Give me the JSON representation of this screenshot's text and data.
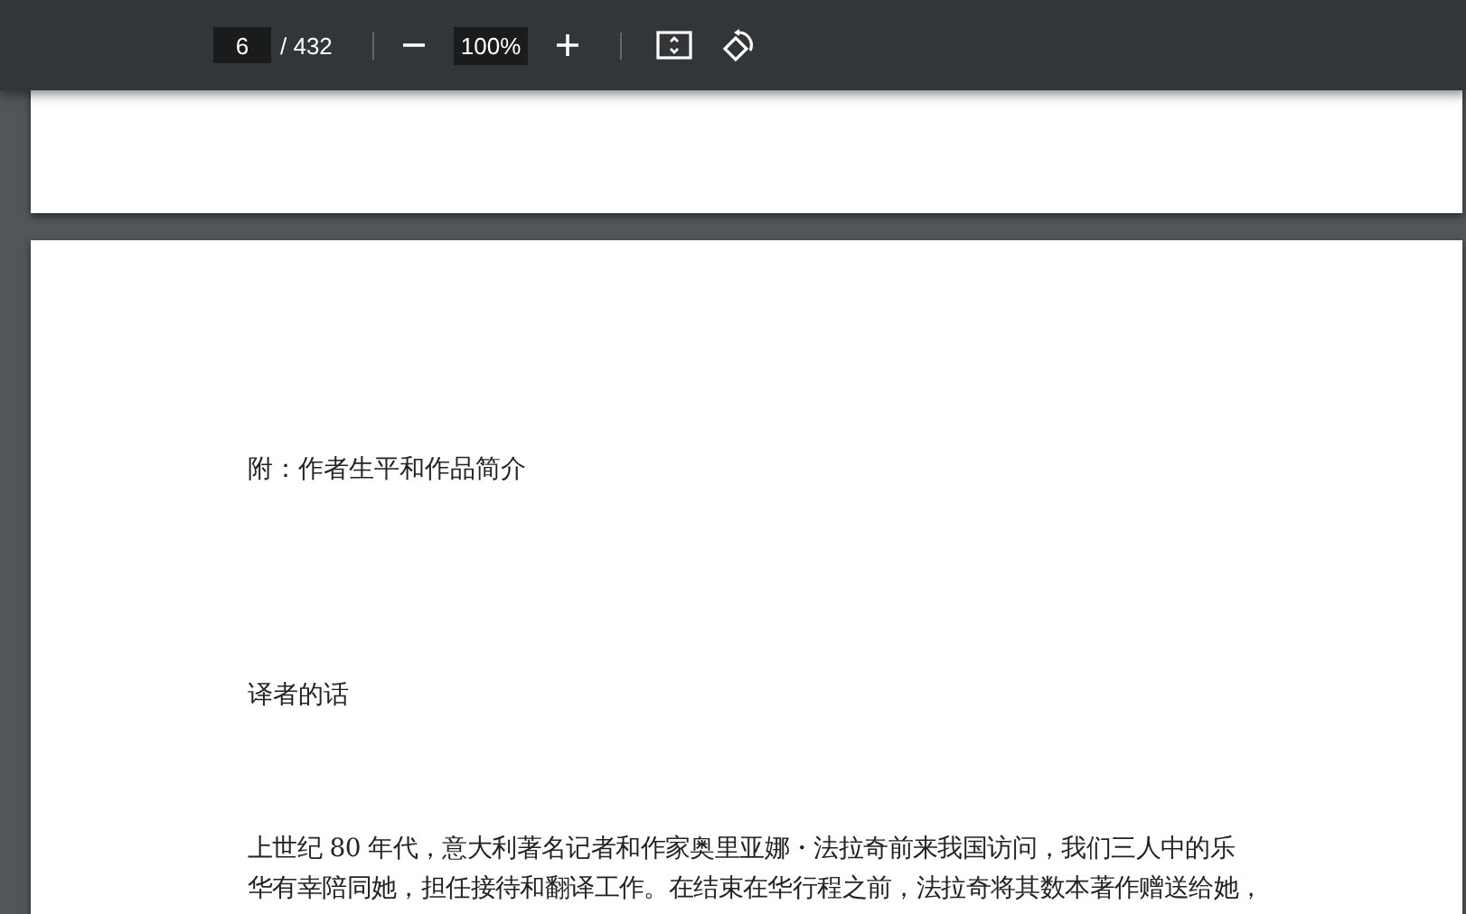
{
  "toolbar": {
    "page_number": "6",
    "page_total": "/ 432",
    "zoom": "100%"
  },
  "page": {
    "heading": "附：作者生平和作品简介",
    "section_title": "译者的话",
    "paragraph_lines": [
      "上世纪 80 年代，意大利著名记者和作家奥里亚娜・法拉奇前来我国访问，我们三人中的乐",
      "华有幸陪同她，担任接待和翻译工作。在结束在华行程之前，法拉奇将其数本著作赠送给她，"
    ]
  }
}
